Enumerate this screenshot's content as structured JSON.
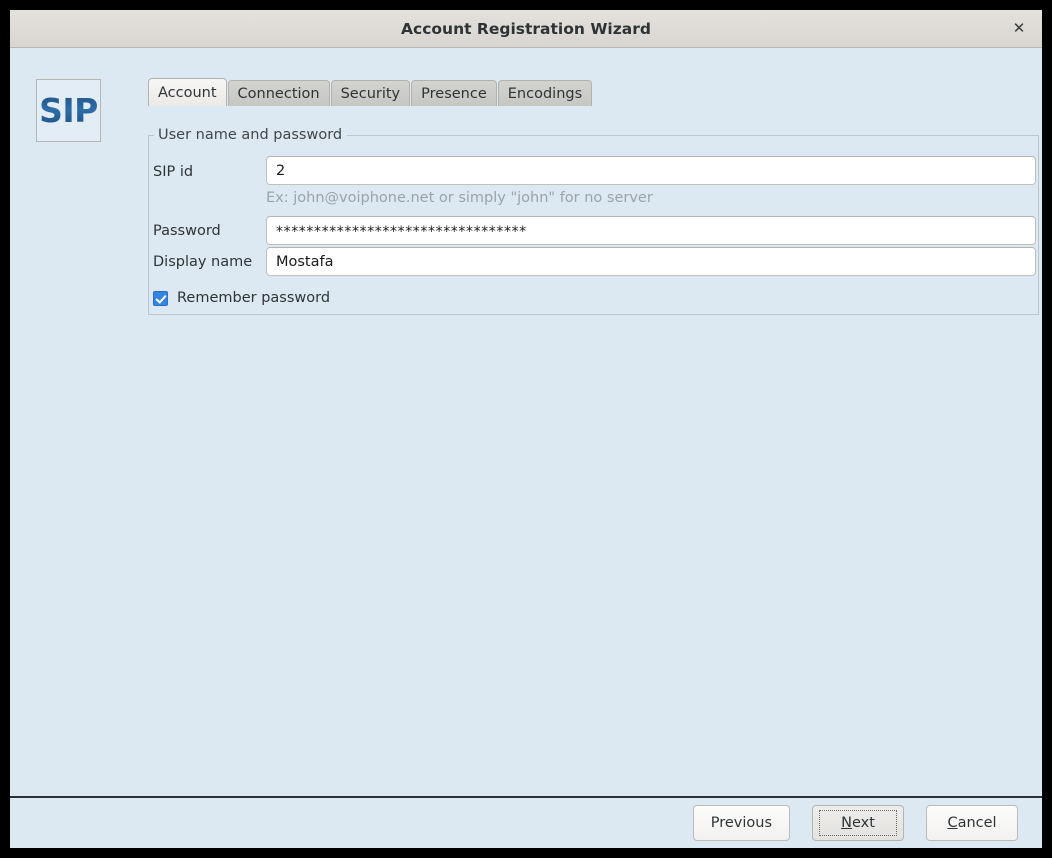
{
  "window": {
    "title": "Account Registration Wizard",
    "close_icon": "close-icon",
    "close_glyph": "✕"
  },
  "logo": {
    "text": "SIP",
    "color": "#1f4f81"
  },
  "tabs": [
    {
      "label": "Account",
      "active": true
    },
    {
      "label": "Connection",
      "active": false
    },
    {
      "label": "Security",
      "active": false
    },
    {
      "label": "Presence",
      "active": false
    },
    {
      "label": "Encodings",
      "active": false
    }
  ],
  "group": {
    "legend": "User name and password"
  },
  "fields": {
    "sip_id": {
      "label": "SIP id",
      "value": "2",
      "placeholder": "",
      "hint": "Ex: john@voiphone.net or simply \"john\" for no server"
    },
    "password": {
      "label": "Password",
      "value": "*********************************",
      "placeholder": ""
    },
    "display_name": {
      "label": "Display name",
      "value": "Mostafa",
      "placeholder": ""
    }
  },
  "checkbox": {
    "label": "Remember password",
    "checked": true,
    "accent": "#3584e4"
  },
  "footer": {
    "buttons": [
      {
        "label": "Previous",
        "mnemonic": "",
        "focused": false
      },
      {
        "label": "Next",
        "mnemonic": "N",
        "focused": true
      },
      {
        "label": "Cancel",
        "mnemonic": "C",
        "focused": false
      }
    ]
  }
}
